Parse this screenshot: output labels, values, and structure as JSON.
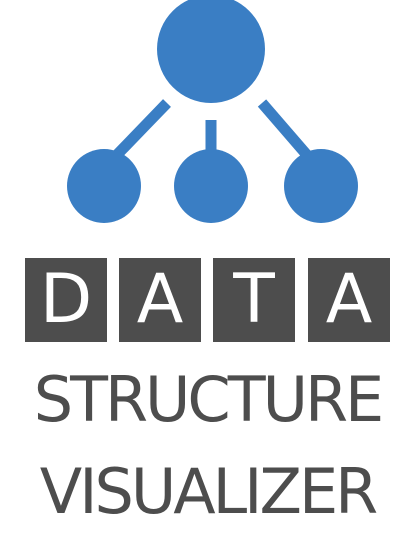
{
  "logo": {
    "icon": "tree-hierarchy-icon",
    "letters": [
      "D",
      "A",
      "T",
      "A"
    ],
    "line1": "STRUCTURE",
    "line2": "VISUALIZER",
    "colors": {
      "node_blue": "#3a7ec4",
      "tile_gray": "#4d4d4d",
      "text_gray": "#4d4d4d",
      "tile_text": "#ffffff",
      "background": "#ffffff"
    }
  }
}
